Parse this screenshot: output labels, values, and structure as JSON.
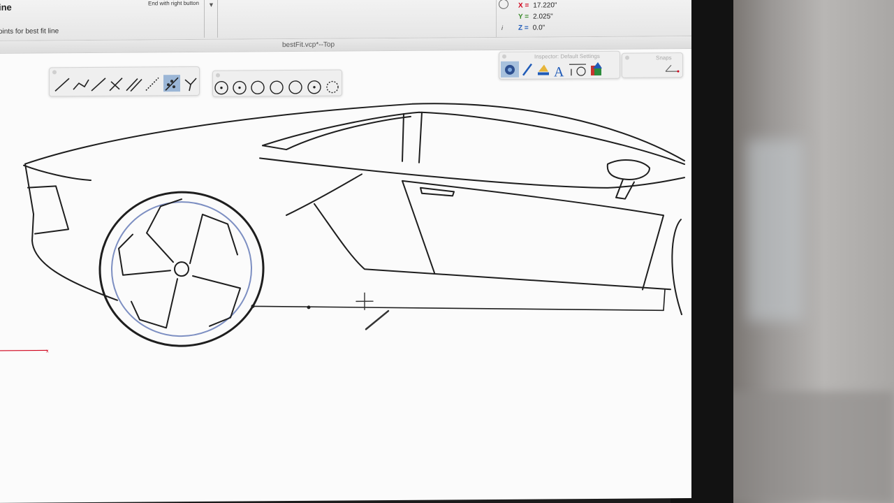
{
  "prompt": {
    "title": "ine",
    "subtitle": "oints for best fit line",
    "end_hint": "End with right button"
  },
  "coords": {
    "x_label": "X =",
    "x_value": "17.220\"",
    "y_label": "Y =",
    "y_value": "2.025\"",
    "z_label": "Z =",
    "z_value": "0.0\""
  },
  "window": {
    "title": "bestFit.vcp*--Top"
  },
  "inspector": {
    "title": "Inspector: Default Settings"
  },
  "snaps": {
    "title": "Snaps"
  },
  "colors": {
    "x": "#d0021b",
    "y": "#3a8a2a",
    "z": "#1f5bb8",
    "selected_tool": "#9bb6d6"
  },
  "line_tools": [
    "line-icon",
    "polyline-icon",
    "single-line-icon",
    "perpendicular-line-icon",
    "parallel-line-icon",
    "dashed-line-icon",
    "best-fit-line-icon",
    "bisector-line-icon"
  ],
  "circle_tools": [
    "circle-center-radius-icon",
    "circle-center-point-icon",
    "circle-two-point-icon",
    "circle-three-point-icon",
    "circle-tangent-icon",
    "circle-tangent-two-icon",
    "circle-best-fit-icon"
  ],
  "inspector_tools": [
    "render-settings-icon",
    "pen-icon",
    "layer-icon",
    "text-icon",
    "dimension-icon",
    "color-icon"
  ]
}
